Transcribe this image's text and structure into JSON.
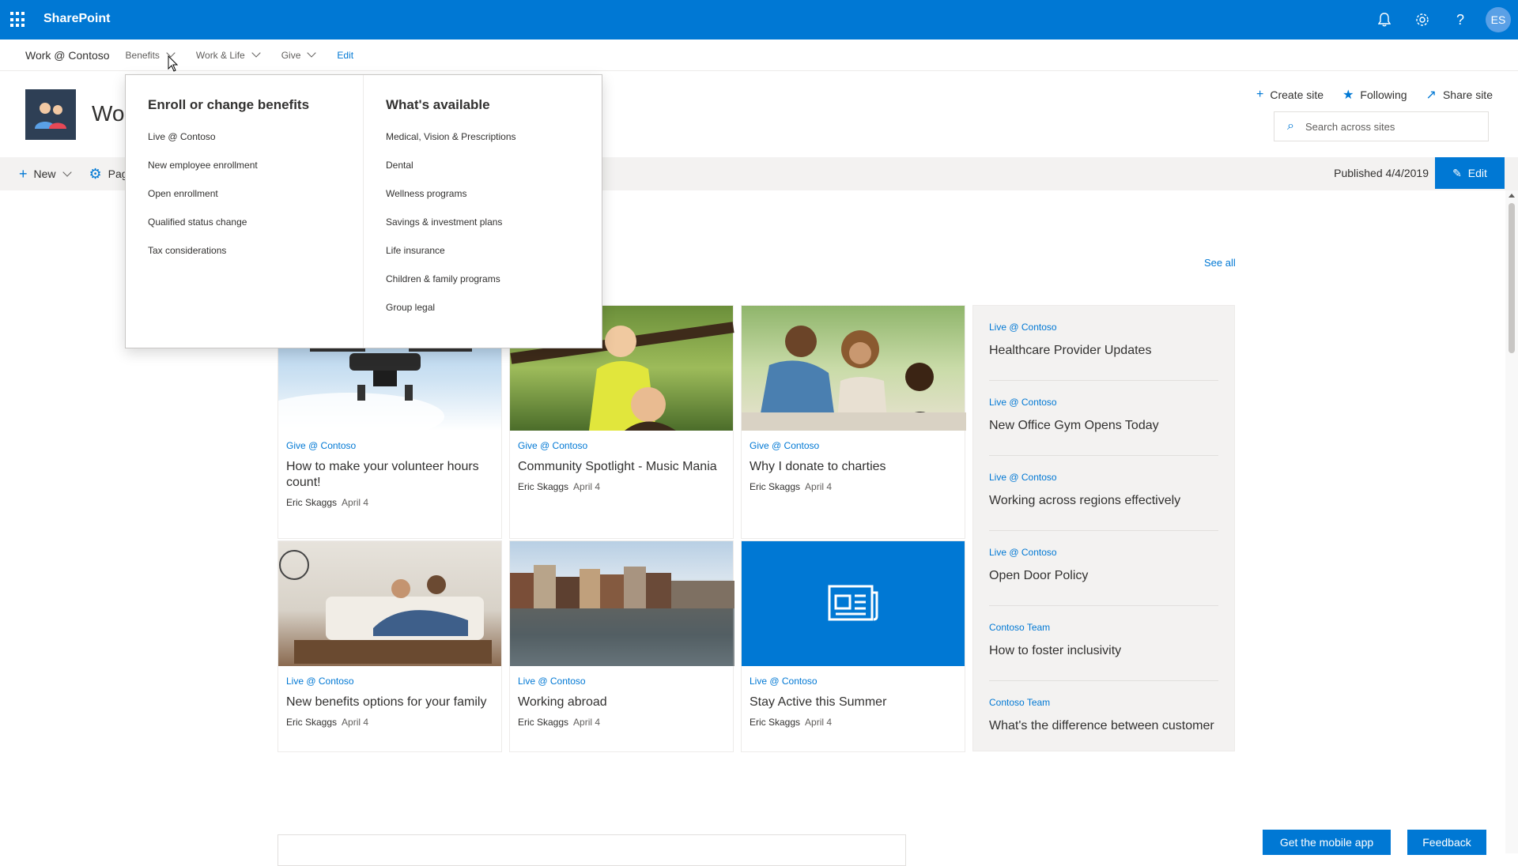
{
  "suitebar": {
    "brand": "SharePoint",
    "avatar_initials": "ES",
    "icons": [
      "notification-bell-icon",
      "settings-gear-icon",
      "help-icon"
    ]
  },
  "hubnav": {
    "title": "Work @ Contoso",
    "items": [
      {
        "label": "Benefits"
      },
      {
        "label": "Work & Life"
      },
      {
        "label": "Give"
      }
    ],
    "edit_label": "Edit"
  },
  "site": {
    "title_partial": "Wor",
    "actions": [
      {
        "label": "Create site",
        "icon": "plus-icon"
      },
      {
        "label": "Following",
        "icon": "star-icon"
      },
      {
        "label": "Share site",
        "icon": "share-icon"
      }
    ],
    "search_placeholder": "Search across sites"
  },
  "cmdbar": {
    "new_label": "New",
    "page_label_partial": "Pag",
    "published": "Published 4/4/2019",
    "edit_label": "Edit"
  },
  "megamenu": {
    "col1": {
      "heading": "Enroll or change benefits",
      "links": [
        "Live @ Contoso",
        "New employee enrollment",
        "Open enrollment",
        "Qualified status change",
        "Tax considerations"
      ]
    },
    "col2": {
      "heading": "What's available",
      "links": [
        "Medical, Vision & Prescriptions",
        "Dental",
        "Wellness programs",
        "Savings & investment plans",
        "Life insurance",
        "Children & family programs",
        "Group legal"
      ]
    }
  },
  "news": {
    "see_all": "See all",
    "cards": [
      {
        "source": "Give @ Contoso",
        "title": "How to make your volunteer hours count!",
        "author": "Eric Skaggs",
        "date": "April 4"
      },
      {
        "source": "Give @ Contoso",
        "title": "Community Spotlight - Music Mania",
        "author": "Eric Skaggs",
        "date": "April 4"
      },
      {
        "source": "Give @ Contoso",
        "title": "Why I donate to charties",
        "author": "Eric Skaggs",
        "date": "April 4"
      },
      {
        "source": "Live @ Contoso",
        "title": "New benefits options for your family",
        "author": "Eric Skaggs",
        "date": "April 4"
      },
      {
        "source": "Live @ Contoso",
        "title": "Working abroad",
        "author": "Eric Skaggs",
        "date": "April 4"
      },
      {
        "source": "Live @ Contoso",
        "title": "Stay Active this Summer",
        "author": "Eric Skaggs",
        "date": "April 4"
      }
    ],
    "list": [
      {
        "source": "Live @ Contoso",
        "title": "Healthcare Provider Updates"
      },
      {
        "source": "Live @ Contoso",
        "title": "New Office Gym Opens Today"
      },
      {
        "source": "Live @ Contoso",
        "title": "Working across regions effectively"
      },
      {
        "source": "Live @ Contoso",
        "title": "Open Door Policy"
      },
      {
        "source": "Contoso Team",
        "title": "How to foster inclusivity"
      },
      {
        "source": "Contoso Team",
        "title": "What's the difference between customer ..."
      }
    ]
  },
  "footer": {
    "mobile_app": "Get the mobile app",
    "feedback": "Feedback"
  },
  "colors": {
    "accent": "#0078d4",
    "text": "#323130"
  }
}
